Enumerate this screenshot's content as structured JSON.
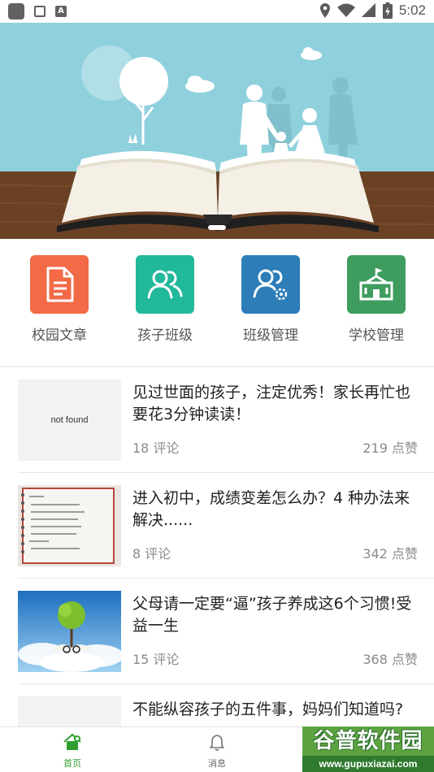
{
  "status_bar": {
    "time": "5:02",
    "icons": [
      "app-icon",
      "notification-icon",
      "a-icon",
      "location-icon",
      "wifi-icon",
      "signal-icon",
      "battery-icon"
    ]
  },
  "banner": {
    "icon": "open-book-family-illustration",
    "active_slide": 1
  },
  "quick_menu": [
    {
      "label": "校园文章",
      "icon": "document-icon",
      "color": "#f26a46"
    },
    {
      "label": "孩子班级",
      "icon": "people-icon",
      "color": "#22b89a"
    },
    {
      "label": "班级管理",
      "icon": "people-gear-icon",
      "color": "#2c7db8"
    },
    {
      "label": "学校管理",
      "icon": "school-icon",
      "color": "#3e9c5f"
    }
  ],
  "articles": [
    {
      "title": "见过世面的孩子，注定优秀！家长再忙也要花3分钟读读！",
      "comments": "18 评论",
      "likes": "219 点赞",
      "thumb": "not found"
    },
    {
      "title": "进入初中，成绩变差怎么办？4 种办法来解决......",
      "comments": "8 评论",
      "likes": "342 点赞",
      "thumb": "notebook-image"
    },
    {
      "title": "父母请一定要“逼”孩子养成这6个习惯!受益一生",
      "comments": "15 评论",
      "likes": "368 点赞",
      "thumb": "tree-book-image"
    },
    {
      "title": "不能纵容孩子的五件事，妈妈们知道吗?",
      "comments": "",
      "likes": "",
      "thumb": "blank"
    }
  ],
  "bottom_nav": [
    {
      "label": "首页",
      "icon": "home-icon",
      "active": true
    },
    {
      "label": "消息",
      "icon": "bell-icon",
      "active": false
    }
  ],
  "colors": {
    "accent": "#2fa02f",
    "sky": "#8fd0dd",
    "muted_text": "#8a8a8a"
  },
  "watermark": {
    "title": "谷普软件园",
    "url": "www.gupuxiazai.com"
  }
}
